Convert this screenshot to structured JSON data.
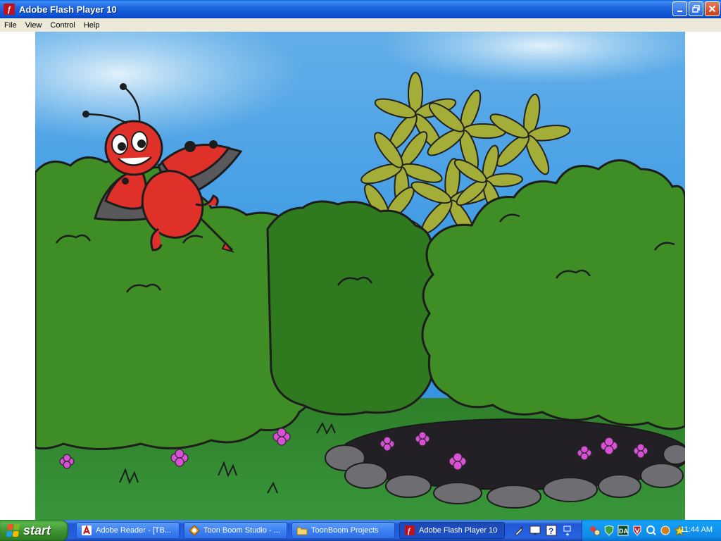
{
  "window": {
    "title": "Adobe Flash Player 10",
    "icon": "flash-player-icon",
    "controls": [
      "minimize",
      "restore",
      "close"
    ]
  },
  "menu": {
    "items": [
      "File",
      "View",
      "Control",
      "Help"
    ]
  },
  "stage": {
    "description_icon": "animation-stage",
    "scene_colors": {
      "sky_top": "#4fa3e6",
      "sky_bottom": "#cfe9f9",
      "bush": "#3d8a24",
      "bush_dark": "#2d6d1b",
      "grass": "#2f8a2c",
      "dirt": "#232023",
      "ladybug_red": "#e0302a",
      "flower_pink": "#d64fd6",
      "leaf_olive": "#a3ad38"
    }
  },
  "taskbar": {
    "start_label": "start",
    "tasks": [
      {
        "label": "Adobe Reader - [TB...",
        "icon": "adobe-reader-icon",
        "active": false
      },
      {
        "label": "Toon Boom Studio - ...",
        "icon": "toon-boom-icon",
        "active": false
      },
      {
        "label": "ToonBoom Projects",
        "icon": "folder-icon",
        "active": false
      },
      {
        "label": "Adobe Flash Player 10",
        "icon": "flash-player-icon",
        "active": true
      }
    ],
    "quicklaunch": [
      "pen-tool-icon",
      "display-icon",
      "help-icon",
      "windows-icon"
    ],
    "tray_icons": [
      "network-icon",
      "shield-icon",
      "da-icon",
      "antivirus-icon",
      "search-icon",
      "media-icon",
      "star-icon"
    ],
    "clock": "11:44 AM"
  }
}
